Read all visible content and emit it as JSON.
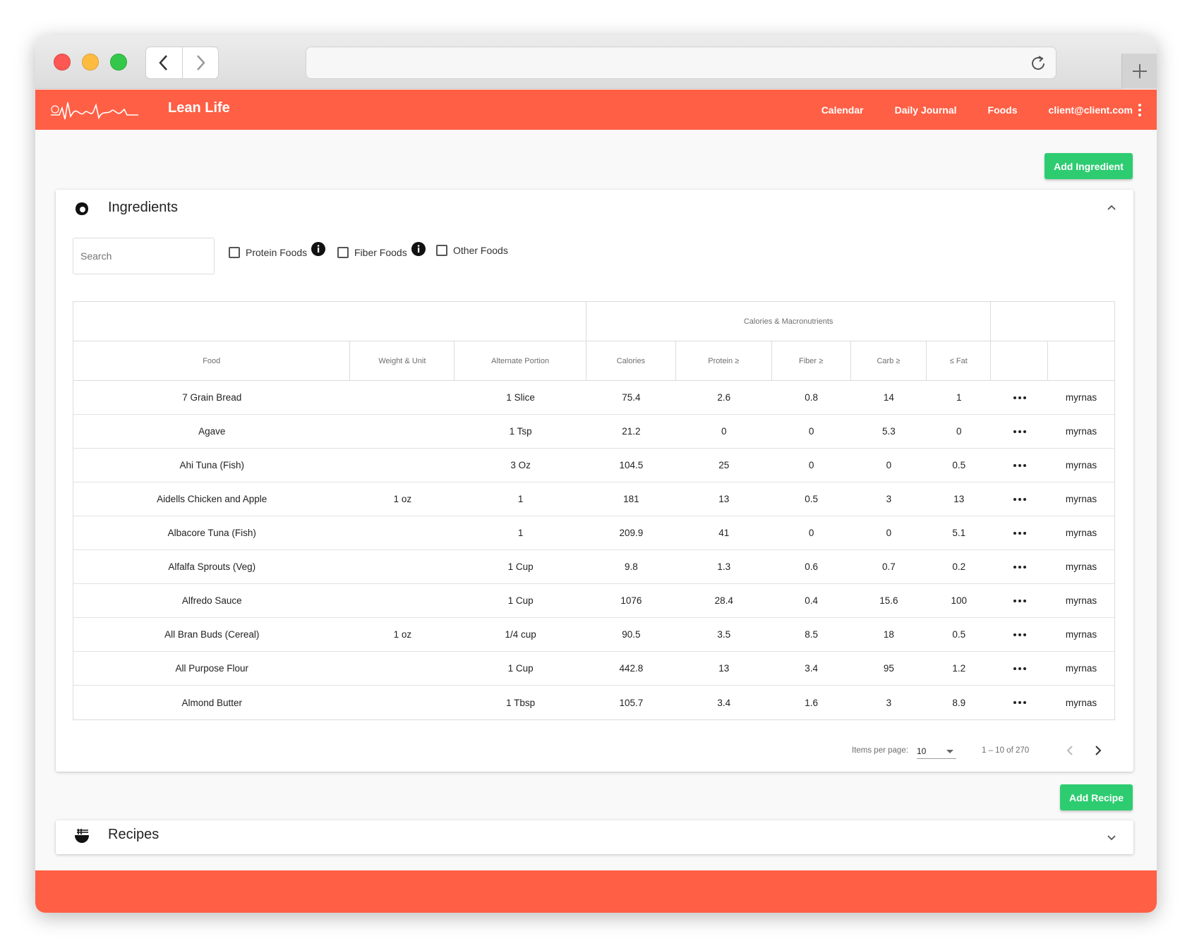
{
  "app": {
    "title": "Lean Life"
  },
  "nav": {
    "calendar": "Calendar",
    "journal": "Daily Journal",
    "foods": "Foods",
    "user": "client@client.com"
  },
  "buttons": {
    "add_ingredient": "Add Ingredient",
    "add_recipe": "Add Recipe"
  },
  "ingredients": {
    "title": "Ingredients",
    "search_placeholder": "Search",
    "filters": {
      "protein": "Protein Foods",
      "fiber": "Fiber Foods",
      "other": "Other Foods"
    },
    "group_header": "Calories & Macronutrients",
    "columns": {
      "food": "Food",
      "weight_unit": "Weight & Unit",
      "alt": "Alternate Portion",
      "calories": "Calories",
      "protein": "Protein ≥",
      "fiber": "Fiber ≥",
      "carb": "Carb ≥",
      "fat": "≤ Fat"
    },
    "rows": [
      {
        "food": "7 Grain Bread",
        "weight_unit": "",
        "alt": "1 Slice",
        "calories": "75.4",
        "protein": "2.6",
        "fiber": "0.8",
        "carb": "14",
        "fat": "1",
        "user": "myrnas"
      },
      {
        "food": "Agave",
        "weight_unit": "",
        "alt": "1 Tsp",
        "calories": "21.2",
        "protein": "0",
        "fiber": "0",
        "carb": "5.3",
        "fat": "0",
        "user": "myrnas"
      },
      {
        "food": "Ahi Tuna (Fish)",
        "weight_unit": "",
        "alt": "3 Oz",
        "calories": "104.5",
        "protein": "25",
        "fiber": "0",
        "carb": "0",
        "fat": "0.5",
        "user": "myrnas"
      },
      {
        "food": "Aidells Chicken and Apple",
        "weight_unit": "1 oz",
        "alt": "1",
        "calories": "181",
        "protein": "13",
        "fiber": "0.5",
        "carb": "3",
        "fat": "13",
        "user": "myrnas"
      },
      {
        "food": "Albacore Tuna (Fish)",
        "weight_unit": "",
        "alt": "1",
        "calories": "209.9",
        "protein": "41",
        "fiber": "0",
        "carb": "0",
        "fat": "5.1",
        "user": "myrnas"
      },
      {
        "food": "Alfalfa Sprouts (Veg)",
        "weight_unit": "",
        "alt": "1 Cup",
        "calories": "9.8",
        "protein": "1.3",
        "fiber": "0.6",
        "carb": "0.7",
        "fat": "0.2",
        "user": "myrnas"
      },
      {
        "food": "Alfredo Sauce",
        "weight_unit": "",
        "alt": "1 Cup",
        "calories": "1076",
        "protein": "28.4",
        "fiber": "0.4",
        "carb": "15.6",
        "fat": "100",
        "user": "myrnas"
      },
      {
        "food": "All Bran Buds (Cereal)",
        "weight_unit": "1 oz",
        "alt": "1/4 cup",
        "calories": "90.5",
        "protein": "3.5",
        "fiber": "8.5",
        "carb": "18",
        "fat": "0.5",
        "user": "myrnas"
      },
      {
        "food": "All Purpose Flour",
        "weight_unit": "",
        "alt": "1 Cup",
        "calories": "442.8",
        "protein": "13",
        "fiber": "3.4",
        "carb": "95",
        "fat": "1.2",
        "user": "myrnas"
      },
      {
        "food": "Almond Butter",
        "weight_unit": "",
        "alt": "1 Tbsp",
        "calories": "105.7",
        "protein": "3.4",
        "fiber": "1.6",
        "carb": "3",
        "fat": "8.9",
        "user": "myrnas"
      }
    ],
    "paginator": {
      "label": "Items per page:",
      "page_size": "10",
      "range": "1 – 10 of 270"
    }
  },
  "recipes": {
    "title": "Recipes"
  },
  "colors": {
    "brand": "#ff5f45",
    "accent_green": "#2ecc71"
  },
  "icons": {
    "logo": "signature-logo",
    "ingredients": "egg-icon",
    "recipes": "bowl-icon"
  }
}
